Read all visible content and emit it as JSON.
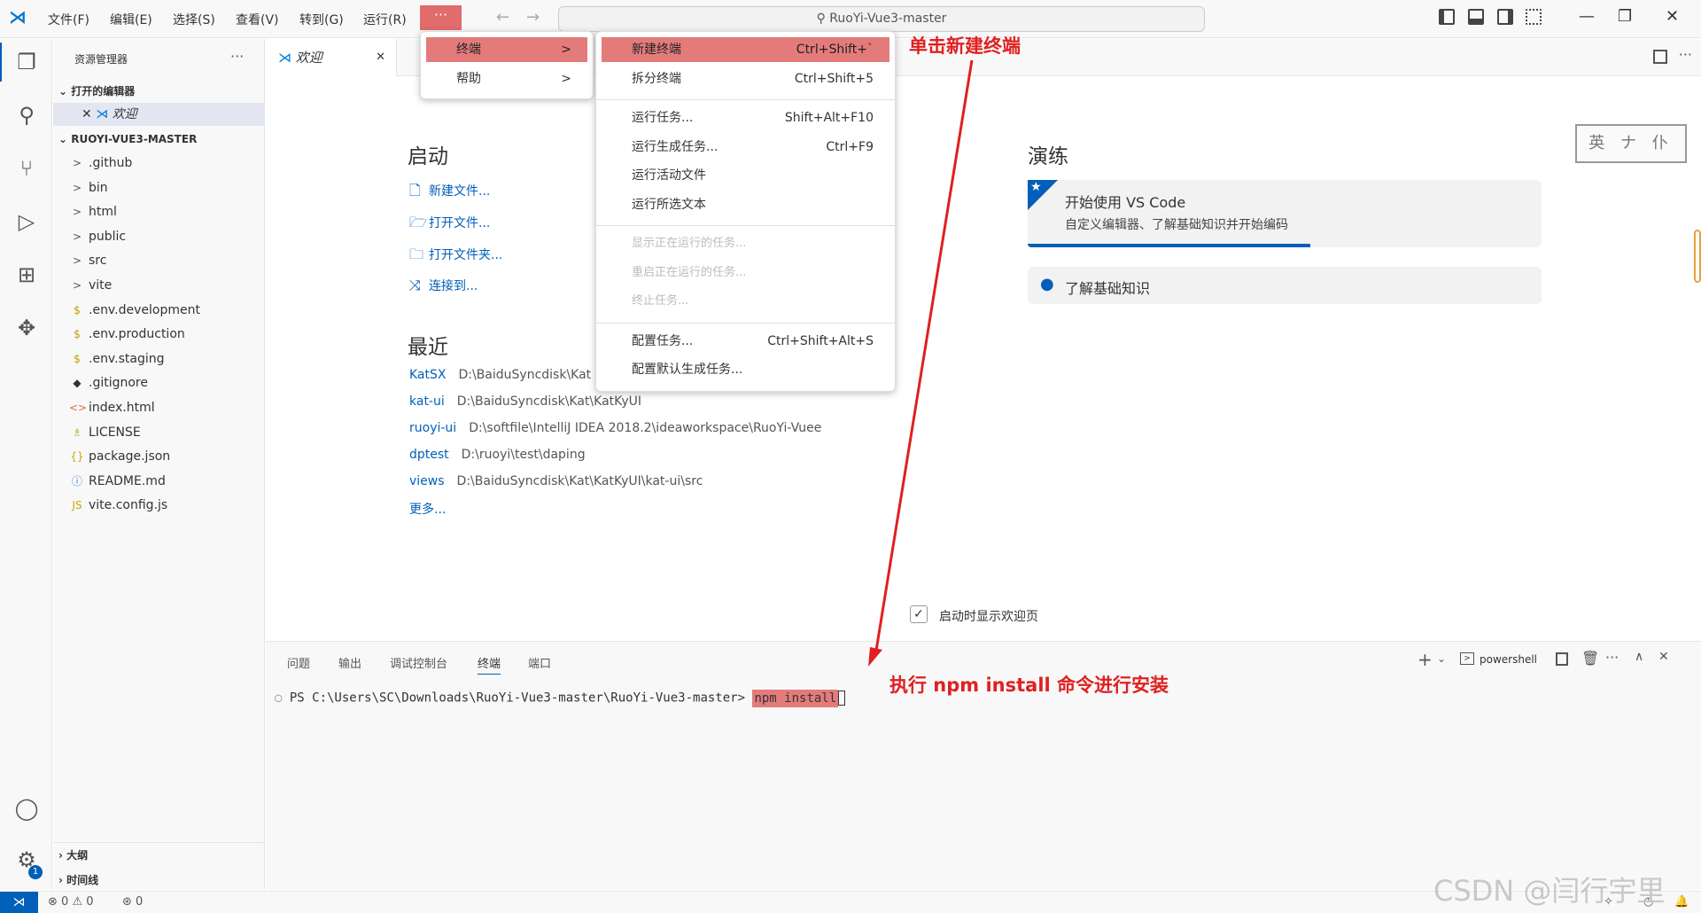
{
  "menubar": [
    "文件(F)",
    "编辑(E)",
    "选择(S)",
    "查看(V)",
    "转到(G)",
    "运行(R)"
  ],
  "ellipsis": "···",
  "search": "RuoYi-Vue3-master",
  "sidebar": {
    "title": "资源管理器",
    "more": "···",
    "open_editors": "打开的编辑器",
    "open_file": "欢迎",
    "project": "RUOYI-VUE3-MASTER",
    "items": [
      {
        "name": ".github",
        "icon": ">"
      },
      {
        "name": "bin",
        "icon": ">"
      },
      {
        "name": "html",
        "icon": ">"
      },
      {
        "name": "public",
        "icon": ">"
      },
      {
        "name": "src",
        "icon": ">"
      },
      {
        "name": "vite",
        "icon": ">"
      },
      {
        "name": ".env.development",
        "icon": "$"
      },
      {
        "name": ".env.production",
        "icon": "$"
      },
      {
        "name": ".env.staging",
        "icon": "$"
      },
      {
        "name": ".gitignore",
        "icon": "◆"
      },
      {
        "name": "index.html",
        "icon": "<>"
      },
      {
        "name": "LICENSE",
        "icon": "♗"
      },
      {
        "name": "package.json",
        "icon": "{}"
      },
      {
        "name": "README.md",
        "icon": "ⓘ"
      },
      {
        "name": "vite.config.js",
        "icon": "JS"
      }
    ],
    "outline": "大纲",
    "timeline": "时间线"
  },
  "tab": {
    "label": "欢迎",
    "close": "✕"
  },
  "welcome": {
    "start_title": "启动",
    "start_links": [
      {
        "icon": "🗋",
        "label": "新建文件..."
      },
      {
        "icon": "🗁",
        "label": "打开文件..."
      },
      {
        "icon": "🗀",
        "label": "打开文件夹..."
      },
      {
        "icon": "⤨",
        "label": "连接到..."
      }
    ],
    "recent_title": "最近",
    "recent": [
      {
        "name": "KatSX",
        "path": "D:\\BaiduSyncdisk\\Kat"
      },
      {
        "name": "kat-ui",
        "path": "D:\\BaiduSyncdisk\\Kat\\KatKyUI"
      },
      {
        "name": "ruoyi-ui",
        "path": "D:\\softfile\\IntelliJ IDEA 2018.2\\ideaworkspace\\RuoYi-Vuee"
      },
      {
        "name": "dptest",
        "path": "D:\\ruoyi\\test\\daping"
      },
      {
        "name": "views",
        "path": "D:\\BaiduSyncdisk\\Kat\\KatKyUI\\kat-ui\\src"
      }
    ],
    "more": "更多...",
    "walk_title": "演练",
    "walk1_title": "开始使用 VS Code",
    "walk1_desc": "自定义编辑器、了解基础知识并开始编码",
    "walk1_progress": 0.55,
    "walk2_title": "了解基础知识",
    "show_on_startup": "启动时显示欢迎页",
    "stamp": "英 ナ 仆"
  },
  "menu1": [
    {
      "label": "终端",
      "arrow": ">"
    },
    {
      "label": "帮助",
      "arrow": ">"
    }
  ],
  "menu2": {
    "group1": [
      {
        "label": "新建终端",
        "key": "Ctrl+Shift+`"
      },
      {
        "label": "拆分终端",
        "key": "Ctrl+Shift+5"
      }
    ],
    "group2": [
      {
        "label": "运行任务...",
        "key": "Shift+Alt+F10"
      },
      {
        "label": "运行生成任务...",
        "key": "Ctrl+F9"
      },
      {
        "label": "运行活动文件",
        "key": ""
      },
      {
        "label": "运行所选文本",
        "key": ""
      }
    ],
    "group3": [
      {
        "label": "显示正在运行的任务..."
      },
      {
        "label": "重启正在运行的任务..."
      },
      {
        "label": "终止任务..."
      }
    ],
    "group4": [
      {
        "label": "配置任务...",
        "key": "Ctrl+Shift+Alt+S"
      },
      {
        "label": "配置默认生成任务...",
        "key": ""
      }
    ]
  },
  "panel": {
    "tabs": [
      "问题",
      "输出",
      "调试控制台",
      "终端",
      "端口"
    ],
    "shell": "powershell",
    "prompt": "PS C:\\Users\\SC\\Downloads\\RuoYi-Vue3-master\\RuoYi-Vue3-master>",
    "command": "npm install"
  },
  "status": {
    "errors": "0",
    "warnings": "0",
    "ports": "0"
  },
  "annotations": {
    "a1": "单击新建终端",
    "a2": "执行 npm install 命令进行安装"
  },
  "watermark": "CSDN @闫行宇里"
}
